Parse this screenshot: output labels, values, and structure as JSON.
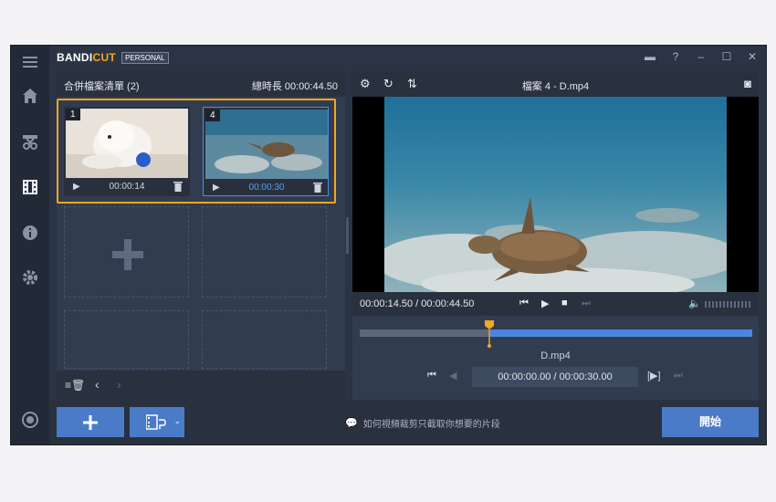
{
  "app": {
    "brand_prefix": "BANDI",
    "brand_suffix": "CUT",
    "edition": "PERSONAL",
    "accent": "#f4a81d",
    "primary": "#4a7bc9"
  },
  "left_panel": {
    "title": "合併檔案清單 (2)",
    "total_duration": "總時長 00:00:44.50",
    "clips": [
      {
        "index": "1",
        "duration": "00:00:14",
        "thumb": "dog"
      },
      {
        "index": "4",
        "duration": "00:00:30",
        "thumb": "turtle"
      }
    ]
  },
  "right_panel": {
    "filename": "檔案 4 - D.mp4",
    "time_display": "00:00:14.50 / 00:00:44.50",
    "timeline_fraction": 0.33,
    "clip_name": "D.mp4",
    "range": "00:00:00.00 / 00:00:30.00"
  },
  "bottom": {
    "tip": "如何視頻裁剪只截取你想要的片段",
    "start_label": "開始"
  }
}
